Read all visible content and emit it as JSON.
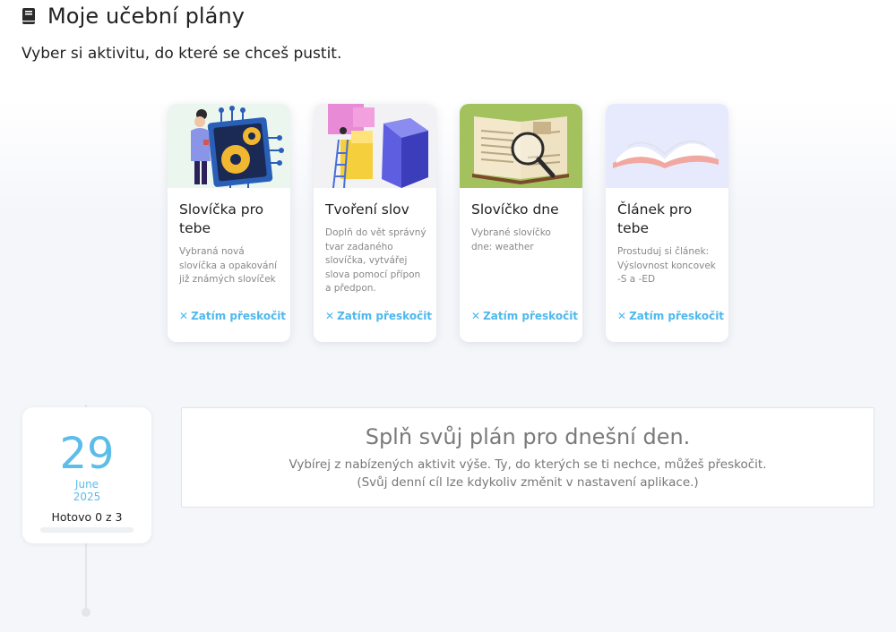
{
  "header": {
    "title": "Moje učební plány",
    "subtitle": "Vyber si aktivitu, do které se chceš pustit."
  },
  "cards": [
    {
      "title": "Slovíčka pro tebe",
      "description": "Vybraná nová slovíčka a opakování již známých slovíček",
      "skip_label": "Zatím přeskočit",
      "art": "person-with-gears-illustration"
    },
    {
      "title": "Tvoření slov",
      "description": "Doplň do vět správný tvar zadaného slovíčka, vytvářej slova pomocí přípon a předpon.",
      "skip_label": "Zatím přeskočit",
      "art": "puzzle-blocks-illustration"
    },
    {
      "title": "Slovíčko dne",
      "description": "Vybrané slovíčko dne: weather",
      "skip_label": "Zatím přeskočit",
      "art": "book-magnifier-illustration"
    },
    {
      "title": "Článek pro tebe",
      "description": "Prostuduj si článek: Výslovnost koncovek -S a -ED",
      "skip_label": "Zatím přeskočit",
      "art": "open-book-illustration"
    }
  ],
  "skip_icon": "close-icon",
  "date": {
    "day": "29",
    "month": "June",
    "year": "2025",
    "done_text": "Hotovo 0 z 3",
    "progress": 0
  },
  "info": {
    "title": "Splň svůj plán pro dnešní den.",
    "line1": "Vybírej z nabízených aktivit výše. Ty, do kterých se ti nechce, můžeš přeskočit.",
    "line2": "(Svůj denní cíl lze kdykoliv změnit v nastavení aplikace.)"
  },
  "colors": {
    "accent": "#5bbde9",
    "link": "#4fb8ec"
  }
}
